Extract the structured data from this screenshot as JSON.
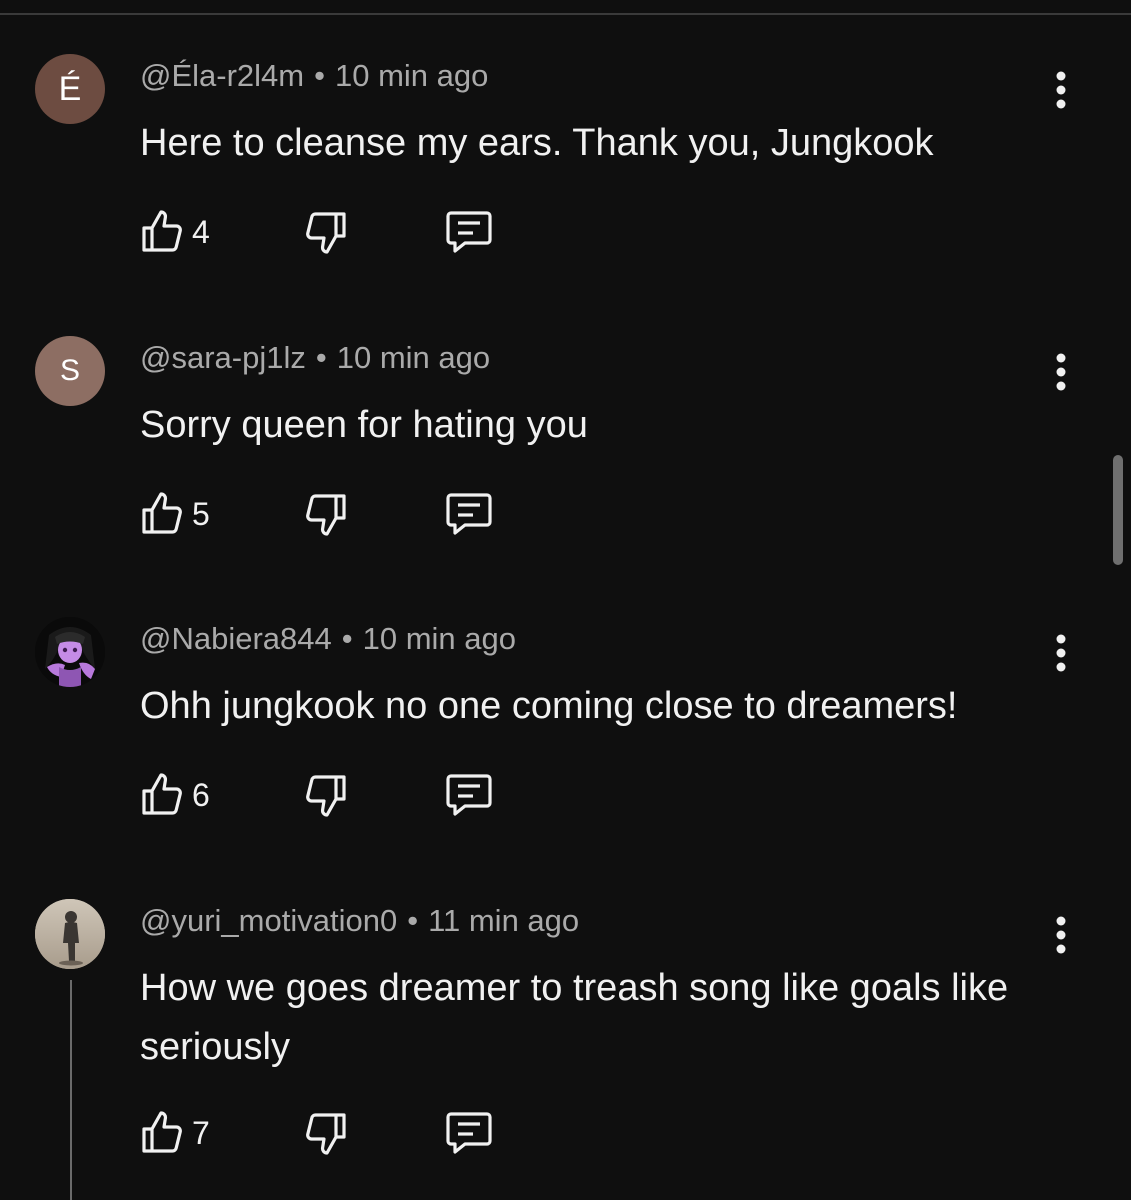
{
  "comments": [
    {
      "avatar_letter": "É",
      "author": "@Éla-r2l4m",
      "separator": "•",
      "time": "10 min ago",
      "text": "Here to cleanse my ears. Thank you, Jungkook",
      "likes": "4"
    },
    {
      "avatar_letter": "S",
      "author": "@sara-pj1lz",
      "separator": "•",
      "time": "10 min ago",
      "text": "Sorry queen for hating you",
      "likes": "5"
    },
    {
      "avatar_letter": "",
      "author": "@Nabiera844",
      "separator": "•",
      "time": "10 min ago",
      "text": "Ohh jungkook no one coming close to dreamers!",
      "likes": "6"
    },
    {
      "avatar_letter": "",
      "author": "@yuri_motivation0",
      "separator": "•",
      "time": "11 min ago",
      "text": "How we goes dreamer to treash song like goals like seriously",
      "likes": "7"
    }
  ],
  "icons": {
    "like": "thumbs-up-icon",
    "dislike": "thumbs-down-icon",
    "reply": "reply-comment-icon",
    "more": "more-vertical-icon"
  },
  "colors": {
    "background": "#0f0f0f",
    "text_primary": "#f1f1f1",
    "text_secondary": "#aaaaaa"
  }
}
